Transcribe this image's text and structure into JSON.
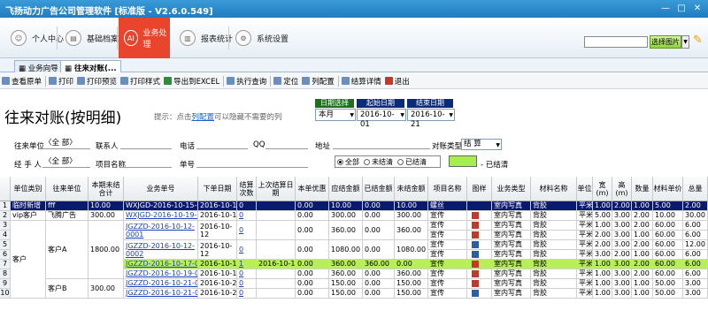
{
  "window": {
    "title": "飞扬动力广告公司管理软件 [标准版 - V2.6.0.549]",
    "min": "—",
    "max": "□",
    "close": "✕"
  },
  "nav": {
    "items": [
      {
        "label": "个人中心",
        "icon": "person-icon"
      },
      {
        "label": "基础档案",
        "icon": "archive-icon"
      },
      {
        "label": "业务处理",
        "icon": "ai-icon",
        "icon_text": "AI"
      },
      {
        "label": "报表统计",
        "icon": "report-icon"
      },
      {
        "label": "系统设置",
        "icon": "gear-icon"
      }
    ],
    "skin_button": "选择图片"
  },
  "tabs": [
    {
      "label": "业务向导"
    },
    {
      "label": "往来对账(..."
    }
  ],
  "toolbar": [
    {
      "label": "查看原单"
    },
    {
      "label": "打印"
    },
    {
      "label": "打印预览"
    },
    {
      "label": "打印样式"
    },
    {
      "label": "导出到EXCEL"
    },
    {
      "label": "执行查询"
    },
    {
      "label": "定位"
    },
    {
      "label": "列配置"
    },
    {
      "label": "结算详情"
    },
    {
      "label": "退出"
    }
  ],
  "page": {
    "title": "往来对账(按明细)",
    "hint_prefix": "提示：点击",
    "hint_link": "列配置",
    "hint_suffix": "可以隐藏不需要的列"
  },
  "dates": {
    "select_label": "日期选择",
    "select_value": "本月",
    "start_label": "起始日期",
    "start_value": "2016-10-01",
    "end_label": "结束日期",
    "end_value": "2016-10-21"
  },
  "filters": {
    "unit_label": "往来单位",
    "unit_value": "〈全 部〉",
    "contact_label": "联系人",
    "phone_label": "电话",
    "qq_label": "QQ",
    "address_label": "地址",
    "type_label": "对账类型",
    "type_value": "结 算",
    "handler_label": "经 手 人",
    "handler_value": "〈全 部〉",
    "project_label": "项目名称",
    "order_label": "单号",
    "radios": [
      "全部",
      "未结清",
      "已结清"
    ],
    "radio_selected": 0,
    "settled_legend": "- 已结清"
  },
  "grid": {
    "headers": [
      "单位类别",
      "往来单位",
      "本期未结合计",
      "业务单号",
      "下单日期",
      "结算次数",
      "上次结算日期",
      "本单优惠",
      "应结金额",
      "已结金额",
      "未结金额",
      "项目名称",
      "图样",
      "业务类型",
      "材料名称",
      "单位",
      "宽(m)",
      "高(m)",
      "数量",
      "材料单价",
      "总量"
    ],
    "rows": [
      {
        "n": "1",
        "cat": "临时新增",
        "unit": "fff",
        "sum": "10.00",
        "order": "WXJGD-2016-10-15-0001",
        "date": "2016-10-15",
        "times": "0",
        "last": "",
        "disc": "0.00",
        "due": "10.00",
        "paid": "0.00",
        "unpaid": "10.00",
        "proj": "螺丝",
        "img": "",
        "btype": "室内写真",
        "mat": "背胶",
        "u": "平米",
        "w": "1.00",
        "h": "2.00",
        "qty": "1.00",
        "price": "5.00",
        "tot": "2.00"
      },
      {
        "n": "2",
        "cat": "vip客户",
        "unit": "飞腾广告",
        "sum": "300.00",
        "order": "WXJGD-2016-10-19-0001",
        "date": "2016-10-19",
        "times": "0",
        "last": "",
        "disc": "0.00",
        "due": "300.00",
        "paid": "0.00",
        "unpaid": "300.00",
        "proj": "宣传",
        "img": "图",
        "btype": "室内写真",
        "mat": "背胶",
        "u": "平米",
        "w": "5.00",
        "h": "3.00",
        "qty": "2.00",
        "price": "10.00",
        "tot": "30.00"
      },
      {
        "n": "3",
        "cat": "",
        "unit": "",
        "sum": "",
        "order": "JGZZD-2016-10-12-0001",
        "date": "2016-10-12",
        "times": "0",
        "last": "",
        "disc": "0.00",
        "due": "360.00",
        "paid": "0.00",
        "unpaid": "360.00",
        "proj": "宣传",
        "img": "图",
        "btype": "室内写真",
        "mat": "背胶",
        "u": "平米",
        "w": "1.00",
        "h": "3.00",
        "qty": "2.00",
        "price": "60.00",
        "tot": "6.00"
      },
      {
        "n": "4",
        "cat": "",
        "unit": "",
        "sum": "",
        "order": "",
        "date": "",
        "times": "",
        "last": "",
        "disc": "",
        "due": "",
        "paid": "",
        "unpaid": "",
        "proj": "宣传",
        "img": "图",
        "btype": "室内写真",
        "mat": "背胶",
        "u": "平米",
        "w": "2.00",
        "h": "3.00",
        "qty": "1.00",
        "price": "60.00",
        "tot": "6.00"
      },
      {
        "n": "5",
        "cat": "",
        "unit": "",
        "sum": "",
        "order": "JGZZD-2016-10-12-0002",
        "date": "2016-10-12",
        "times": "0",
        "last": "",
        "disc": "0.00",
        "due": "1080.00",
        "paid": "0.00",
        "unpaid": "1080.00",
        "proj": "宣传",
        "img": "PS",
        "btype": "室内写真",
        "mat": "背胶",
        "u": "平米",
        "w": "2.00",
        "h": "3.00",
        "qty": "2.00",
        "price": "60.00",
        "tot": "12.00"
      },
      {
        "n": "6",
        "cat": "",
        "unit": "",
        "sum": "",
        "order": "",
        "date": "",
        "times": "",
        "last": "",
        "disc": "",
        "due": "",
        "paid": "",
        "unpaid": "",
        "proj": "宣传",
        "img": "PS",
        "btype": "室内写真",
        "mat": "背胶",
        "u": "平米",
        "w": "3.00",
        "h": "2.00",
        "qty": "1.00",
        "price": "60.00",
        "tot": "6.00"
      },
      {
        "n": "7",
        "cat": "",
        "unit": "",
        "sum": "",
        "order": "JGZZD-2016-10-17-0001",
        "date": "2016-10-17",
        "times": "1",
        "last": "2016-10-17",
        "disc": "0.00",
        "due": "360.00",
        "paid": "360.00",
        "unpaid": "0.00",
        "proj": "宣传",
        "img": "图",
        "btype": "室内写真",
        "mat": "背胶",
        "u": "平米",
        "w": "1.00",
        "h": "3.00",
        "qty": "2.00",
        "price": "60.00",
        "tot": "6.00"
      },
      {
        "n": "8",
        "cat": "",
        "unit": "",
        "sum": "",
        "order": "JGZZD-2016-10-19-0001",
        "date": "2016-10-19",
        "times": "0",
        "last": "",
        "disc": "0.00",
        "due": "360.00",
        "paid": "0.00",
        "unpaid": "360.00",
        "proj": "宣传",
        "img": "图",
        "btype": "室内写真",
        "mat": "背胶",
        "u": "平米",
        "w": "1.00",
        "h": "3.00",
        "qty": "2.00",
        "price": "60.00",
        "tot": "6.00"
      },
      {
        "n": "9",
        "cat": "",
        "unit": "",
        "sum": "",
        "order": "JGZZD-2016-10-21-0001",
        "date": "2016-10-21",
        "times": "0",
        "last": "",
        "disc": "0.00",
        "due": "150.00",
        "paid": "0.00",
        "unpaid": "150.00",
        "proj": "宣传",
        "img": "图",
        "btype": "室内写真",
        "mat": "背胶",
        "u": "平米",
        "w": "1.00",
        "h": "3.00",
        "qty": "1.00",
        "price": "50.00",
        "tot": "3.00"
      },
      {
        "n": "10",
        "cat": "",
        "unit": "",
        "sum": "",
        "order": "JGZZD-2016-10-21-0002",
        "date": "2016-10-21",
        "times": "0",
        "last": "",
        "disc": "0.00",
        "due": "150.00",
        "paid": "0.00",
        "unpaid": "150.00",
        "proj": "宣传",
        "img": "PS",
        "btype": "室内写真",
        "mat": "背胶",
        "u": "平米",
        "w": "1.00",
        "h": "3.00",
        "qty": "1.00",
        "price": "50.00",
        "tot": "3.00"
      }
    ],
    "merged": {
      "cat_kehu": "客户",
      "unit_a": "客户A",
      "sum_a": "1800.00",
      "unit_b": "客户B",
      "sum_b": "300.00"
    }
  },
  "colors": {
    "accent": "#e8452c",
    "title_bar": "#1f7cc0",
    "highlight": "#0a1a6e",
    "settled": "#b6ef5a",
    "link": "#1a3fc0"
  }
}
